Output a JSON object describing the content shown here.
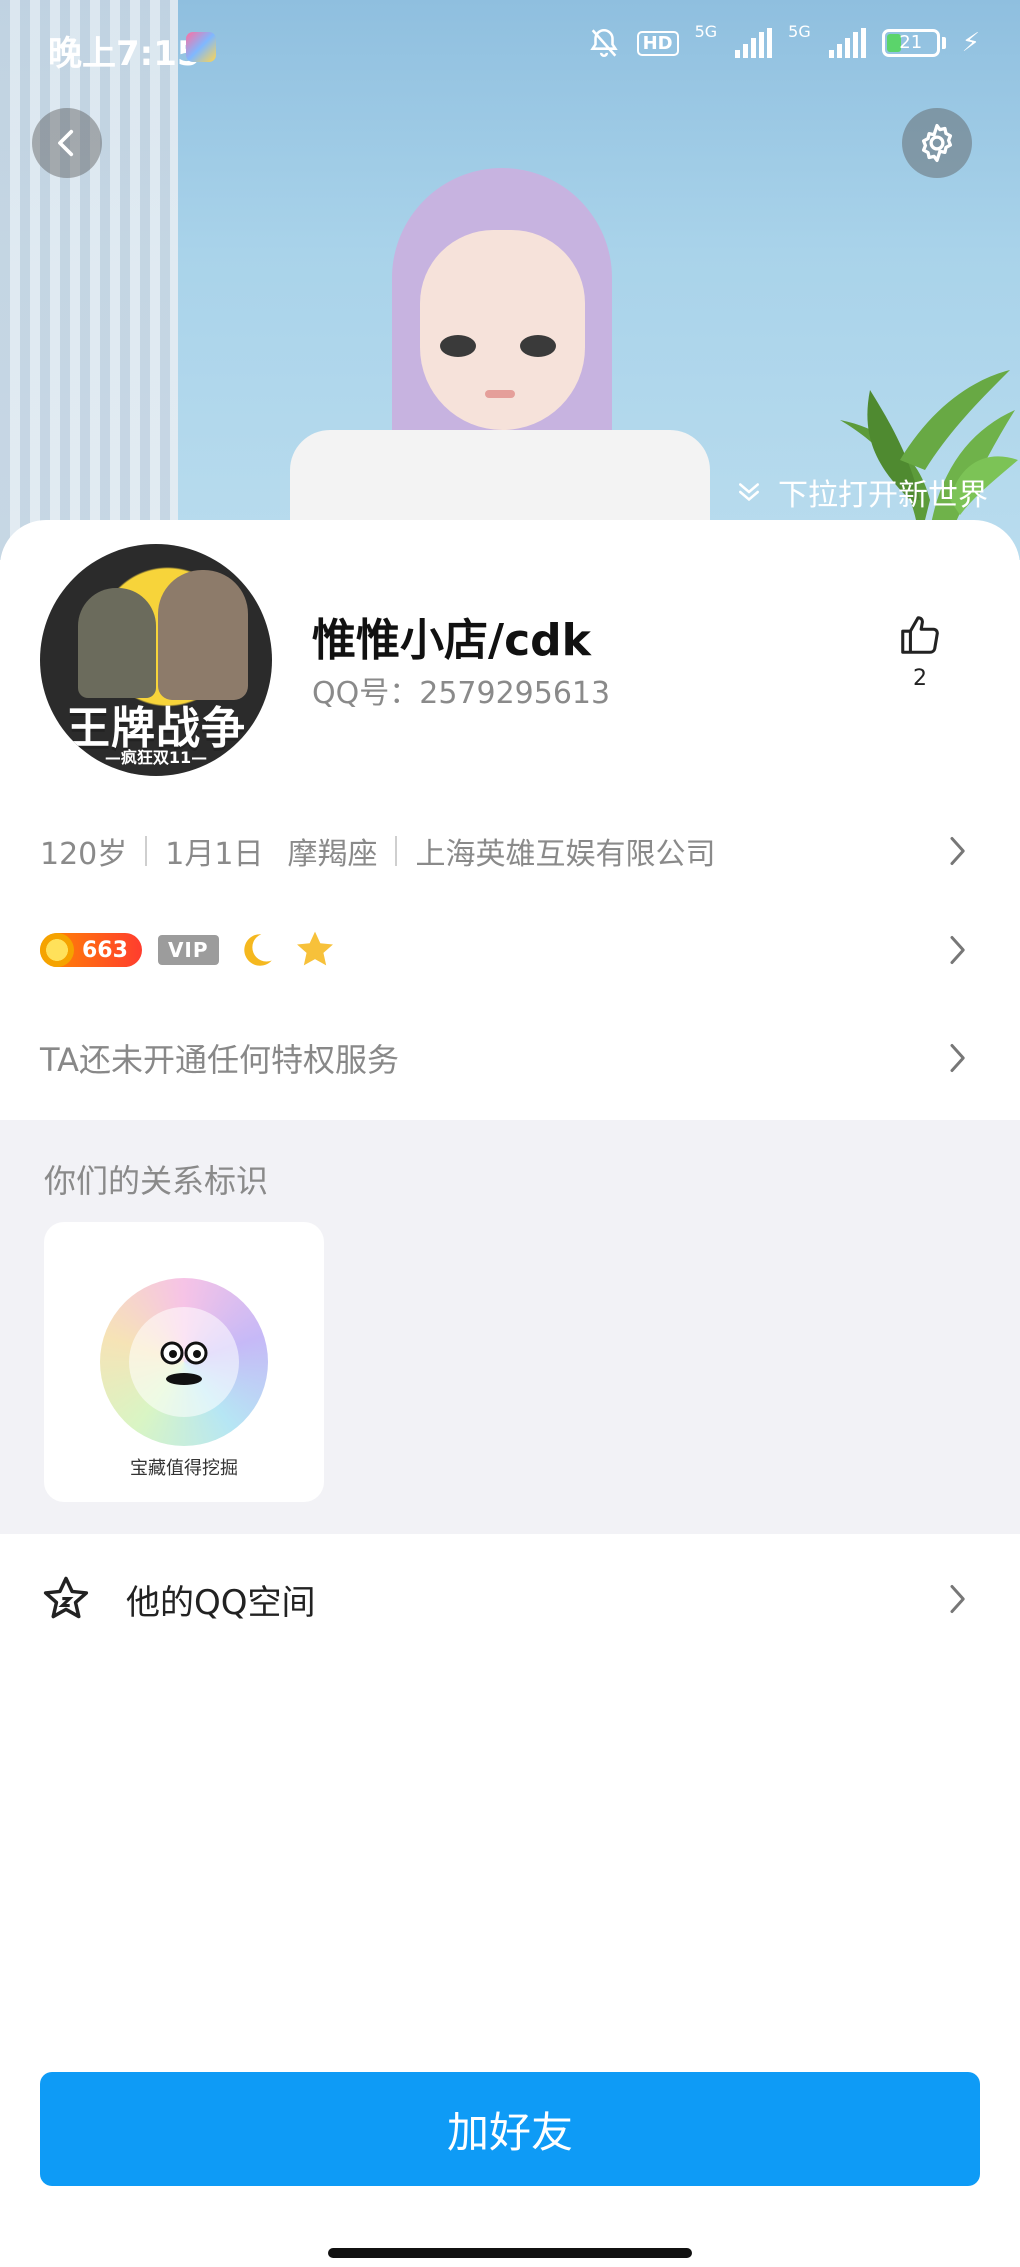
{
  "status_bar": {
    "time": "晚上7:15",
    "hd": "HD",
    "sim1": "5G",
    "sim2": "5G",
    "battery": "21"
  },
  "header": {
    "pull_hint": "下拉打开新世界"
  },
  "profile": {
    "nickname": "惟惟小店/cdk",
    "qq_label": "QQ号：",
    "qq_number": "2579295613",
    "like_count": "2",
    "avatar_text": "王牌战争",
    "avatar_subtext": "—疯狂双11—"
  },
  "info": {
    "age": "120岁",
    "birthday": "1月1日",
    "zodiac": "摩羯座",
    "company": "上海英雄互娱有限公司"
  },
  "badges": {
    "level": "663",
    "vip": "VIP"
  },
  "privilege": {
    "text": "TA还未开通任何特权服务"
  },
  "relation": {
    "title": "你们的关系标识",
    "badge_text": "宝藏值得挖掘"
  },
  "qzone": {
    "label": "他的QQ空间"
  },
  "actions": {
    "add_friend": "加好友"
  },
  "colors": {
    "primary_button": "#0e9bf6",
    "level_badge": "#ff5a1f",
    "vip_badge": "#9c9c9c"
  }
}
